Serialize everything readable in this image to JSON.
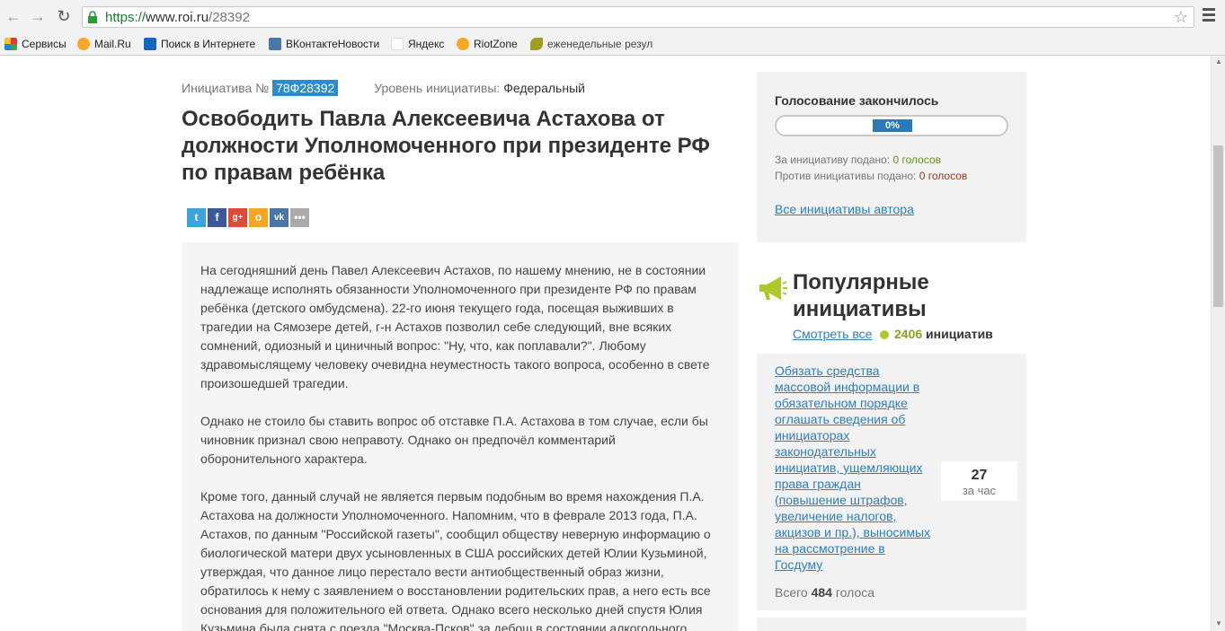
{
  "browser": {
    "url_scheme": "https://",
    "url_host": "www.roi.ru",
    "url_path": "/28392",
    "bookmarks": [
      "Сервисы",
      "Mail.Ru",
      "Поиск в Интернете",
      "ВКонтактеНовости",
      "Яндекс",
      "RiotZone",
      "еженедельные резул"
    ]
  },
  "initiative": {
    "label": "Инициатива №",
    "number": "78Ф28392",
    "level_label": "Уровень инициативы:",
    "level_value": "Федеральный",
    "title": "Освободить Павла Алексеевича Астахова от должности Уполномоченного при президенте РФ по правам ребёнка",
    "share_icons": [
      "twitter-icon",
      "facebook-icon",
      "google-plus-icon",
      "odnoklassniki-icon",
      "vkontakte-icon",
      "more-icon"
    ],
    "paragraphs": [
      "На сегодняшний день Павел Алексеевич Астахов, по нашему мнению, не в состоянии надлежаще исполнять обязанности Уполномоченного при президенте РФ по правам ребёнка (детского омбудсмена). 22-го июня текущего года, посещая выживших в трагедии на Сямозере детей, г-н Астахов позволил себе следующий, вне всяких сомнений, одиозный и циничный вопрос: \"Ну, что, как поплавали?\". Любому здравомыслящему человеку очевидна неуместность такого вопроса, особенно в свете произошедшей трагедии.",
      "Однако не стоило бы ставить вопрос об отставке П.А. Астахова в том случае, если бы чиновник признал свою неправоту. Однако он предпочёл комментарий оборонительного характера.",
      "Кроме того, данный случай не является первым подобным во время нахождения П.А. Астахова на должности Уполномоченного. Напомним, что в феврале 2013 года, П.А. Астахов, по данным \"Российской газеты\", сообщил обществу неверную информацию о биологической матери двух усыновленных в США российских детей Юлии Кузьминой, утверждая, что данное лицо перестало вести антиобщественный образ жизни, обратилось к нему с заявлением о восстановлении родительских прав, а него есть все основания для положительного ей ответа. Однако всего несколько дней спустя Юлия Кузьмина была снята с поезда \"Москва-Псков\" за дебош в состоянии алкогольного"
    ]
  },
  "vote": {
    "title": "Голосование закончилось",
    "percent": "0%",
    "progress_fraction": 0,
    "for_label": "За инициативу подано:",
    "for_count": "0 голосов",
    "against_label": "Против инициативы подано:",
    "against_count": "0 голосов",
    "author_link": "Все инициативы автора"
  },
  "popular": {
    "title": "Популярные инициативы",
    "see_all": "Смотреть все",
    "count": "2406",
    "count_label": "инициатив",
    "item": {
      "text": "Обязать средства массовой информации в обязательном порядке оглашать сведения об инициаторах законодательных инициатив, ущемляющих права граждан (повышение штрафов, увеличение налогов, акцизов и пр.), выносимых на рассмотрение в Госдуму",
      "rate_value": "27",
      "rate_unit": "за час",
      "total_label": "Всего",
      "total_value": "484",
      "total_unit": "голоса"
    }
  },
  "colors": {
    "accent": "#2d8bd0",
    "link": "#2f7ebf",
    "green": "#8aa21d",
    "red": "#a3321e"
  }
}
